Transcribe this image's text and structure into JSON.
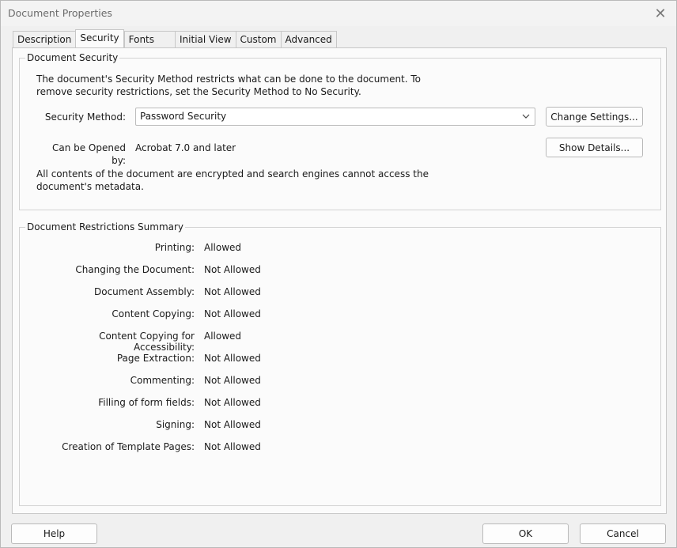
{
  "window": {
    "title": "Document Properties"
  },
  "tabs": [
    {
      "label": "Description",
      "active": false
    },
    {
      "label": "Security",
      "active": true
    },
    {
      "label": "Fonts",
      "active": false
    },
    {
      "label": "Initial View",
      "active": false
    },
    {
      "label": "Custom",
      "active": false
    },
    {
      "label": "Advanced",
      "active": false
    }
  ],
  "security": {
    "group_title": "Document Security",
    "description": "The document's Security Method restricts what can be done to the document. To remove security restrictions, set the Security Method to No Security.",
    "method_label": "Security Method:",
    "method_value": "Password Security",
    "change_settings_label": "Change Settings...",
    "opened_by_label": "Can be Opened by:",
    "opened_by_value": "Acrobat 7.0 and later",
    "show_details_label": "Show Details...",
    "encryption_note": "All contents of the document are encrypted and search engines cannot access the document's metadata."
  },
  "restrictions": {
    "group_title": "Document Restrictions Summary",
    "items": [
      {
        "label": "Printing:",
        "value": "Allowed"
      },
      {
        "label": "Changing the Document:",
        "value": "Not Allowed"
      },
      {
        "label": "Document Assembly:",
        "value": "Not Allowed"
      },
      {
        "label": "Content Copying:",
        "value": "Not Allowed"
      },
      {
        "label": "Content Copying for Accessibility:",
        "value": "Allowed"
      },
      {
        "label": "Page Extraction:",
        "value": "Not Allowed"
      },
      {
        "label": "Commenting:",
        "value": "Not Allowed"
      },
      {
        "label": "Filling of form fields:",
        "value": "Not Allowed"
      },
      {
        "label": "Signing:",
        "value": "Not Allowed"
      },
      {
        "label": "Creation of Template Pages:",
        "value": "Not Allowed"
      }
    ]
  },
  "footer": {
    "help_label": "Help",
    "ok_label": "OK",
    "cancel_label": "Cancel"
  }
}
